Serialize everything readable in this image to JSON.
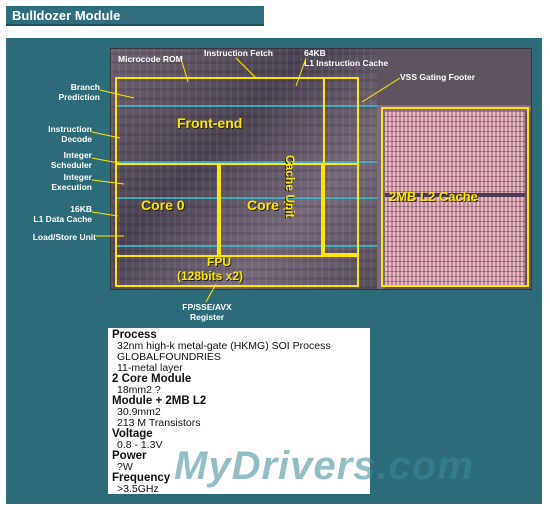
{
  "header": {
    "title": "Bulldozer Module"
  },
  "die": {
    "front_end": "Front-end",
    "core0": "Core 0",
    "core1": "Core 1",
    "cache_unit": "Cache Unit",
    "l2_cache": "2MB L2 Cache",
    "fpu_line1": "FPU",
    "fpu_line2": "(128bits x2)"
  },
  "annotations": {
    "microcode_rom": "Microcode ROM",
    "instruction_fetch": "Instruction Fetch",
    "l1i_line1": "64KB",
    "l1i_line2": "L1 Instruction Cache",
    "vss_gating": "VSS Gating Footer",
    "branch_line1": "Branch",
    "branch_line2": "Prediction",
    "decode_line1": "Instruction",
    "decode_line2": "Decode",
    "int_sched_line1": "Integer",
    "int_sched_line2": "Scheduler",
    "int_exec_line1": "Integer",
    "int_exec_line2": "Execution",
    "l1d_line1": "16KB",
    "l1d_line2": "L1 Data Cache",
    "load_store": "Load/Store Unit",
    "fp_line1": "FP/SSE/AVX",
    "fp_line2": "Register"
  },
  "specs": {
    "process_label": "Process",
    "process_1": "32nm high-k metal-gate (HKMG) SOI Process",
    "process_2": "GLOBALFOUNDRIES",
    "process_3": "11-metal layer",
    "core_module_label": "2 Core Module",
    "core_module_1": "18mm2 ?",
    "module_l2_label": "Module + 2MB L2",
    "module_l2_1": "30.9mm2",
    "module_l2_2": "213 M Transistors",
    "voltage_label": "Voltage",
    "voltage_1": "0.8 - 1.3V",
    "power_label": "Power",
    "power_1": "?W",
    "frequency_label": "Frequency",
    "frequency_1": ">3.5GHz"
  },
  "watermark": "MyDrivers.com",
  "colors": {
    "panel": "#2c6c78",
    "highlight": "#ffe600",
    "l2_cache": "#e9b8c4",
    "title_bar": "#2f6e7c"
  }
}
